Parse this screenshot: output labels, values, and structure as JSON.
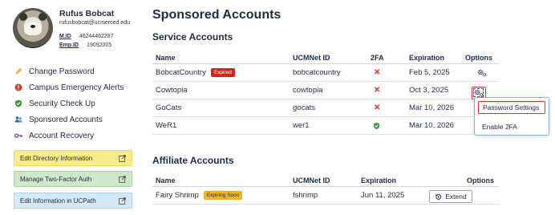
{
  "user": {
    "name": "Rufus Bobcat",
    "email": "rufusbobcat@ucmerced.edu",
    "mid_label": "M.ID",
    "mid_value": "46244462287",
    "emp_label": "Emp.ID",
    "emp_value": "19092005"
  },
  "sidebar": {
    "items": [
      {
        "label": "Change Password",
        "icon": "pencil-icon",
        "color": "#e8a93b"
      },
      {
        "label": "Campus Emergency Alerts",
        "icon": "alert-icon",
        "color": "#d33b2c"
      },
      {
        "label": "Security Check Up",
        "icon": "shield-check-icon",
        "color": "#3f9a3f"
      },
      {
        "label": "Sponsored Accounts",
        "icon": "users-icon",
        "color": "#2f6aa8"
      },
      {
        "label": "Account Recovery",
        "icon": "key-icon",
        "color": "#7c3f9a"
      }
    ],
    "buttons": [
      {
        "label": "Edit Directory Information",
        "color": "#f8ec8a"
      },
      {
        "label": "Manage Two-Factor Auth",
        "color": "#cfe8c9"
      },
      {
        "label": "Edit Information in UCPath",
        "color": "#d5e8f7"
      }
    ]
  },
  "main": {
    "title": "Sponsored Accounts",
    "service": {
      "title": "Service Accounts",
      "headers": {
        "name": "Name",
        "ucmnet": "UCMNet ID",
        "twofa": "2FA",
        "expiration": "Expiration",
        "options": "Options"
      },
      "rows": [
        {
          "name": "BobcatCountry",
          "badge": "Expired",
          "ucmnet": "bobcatcountry",
          "twofa": "no",
          "expiration": "Feb 5, 2025"
        },
        {
          "name": "Cowtopia",
          "badge": "",
          "ucmnet": "cowtopia",
          "twofa": "no",
          "expiration": "Oct 3, 2025"
        },
        {
          "name": "GoCats",
          "badge": "",
          "ucmnet": "gocats",
          "twofa": "no",
          "expiration": "Mar 10, 2026"
        },
        {
          "name": "WeR1",
          "badge": "",
          "ucmnet": "wer1",
          "twofa": "yes",
          "expiration": "Mar 10, 2026"
        }
      ]
    },
    "options_menu": {
      "items": [
        "Password Settings",
        "Enable 2FA"
      ]
    },
    "affiliate": {
      "title": "Affiliate Accounts",
      "headers": {
        "name": "Name",
        "ucmnet": "UCMNet ID",
        "expiration": "Expiration",
        "options": "Options"
      },
      "rows": [
        {
          "name": "Fairy Shrimp",
          "badge": "Expiring Soon",
          "ucmnet": "fshrimp",
          "expiration": "Jun 11, 2025",
          "action": "Extend"
        }
      ]
    }
  }
}
